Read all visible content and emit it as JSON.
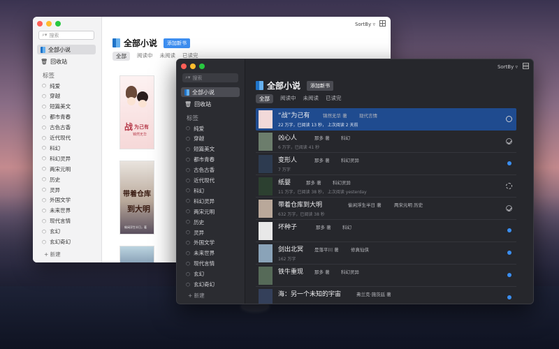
{
  "light_window": {
    "search_placeholder": "搜索",
    "nav": [
      {
        "label": "全部小说",
        "icon": "book-icon"
      },
      {
        "label": "回收站",
        "icon": "trash-icon"
      }
    ],
    "section_tags": "标签",
    "tags": [
      "纯爱",
      "穿越",
      "短篇美文",
      "都市青春",
      "古色古香",
      "近代现代",
      "科幻",
      "科幻灵异",
      "两宋元明",
      "历史",
      "灵异",
      "外国文学",
      "未来世界",
      "现代言情",
      "玄幻",
      "玄幻奇幻"
    ],
    "new_label": "+ 新建",
    "title": "全部小说",
    "add_button": "添加新书",
    "tabs": [
      "全部",
      "阅读中",
      "未阅读",
      "已读完"
    ],
    "sortby": "SortBy ▿",
    "covers": [
      {
        "title_a": "战",
        "title_b": "为己有",
        "author": "锦然无华"
      },
      {
        "title_a": "带着仓库",
        "title_b": "到大明",
        "author": "偷闲浮生半日，著"
      }
    ]
  },
  "dark_window": {
    "search_placeholder": "搜索",
    "nav": [
      {
        "label": "全部小说",
        "icon": "book-icon"
      },
      {
        "label": "回收站",
        "icon": "trash-icon"
      }
    ],
    "section_tags": "标签",
    "tags": [
      "纯爱",
      "穿越",
      "短篇美文",
      "都市青春",
      "古色古香",
      "近代现代",
      "科幻",
      "科幻灵异",
      "两宋元明",
      "历史",
      "灵异",
      "外国文学",
      "未来世界",
      "现代言情",
      "玄幻",
      "玄幻奇幻"
    ],
    "new_label": "+ 新建",
    "title": "全部小说",
    "add_button": "添加新书",
    "tabs": [
      "全部",
      "阅读中",
      "未阅读",
      "已读完"
    ],
    "sortby": "SortBy ▿",
    "books": [
      {
        "name": "“战”为己有",
        "author": "锦然无华 著",
        "tag": "现代言情",
        "sub": "22 万字，已阅读 13 秒，      上次阅读 2 天前",
        "status": "ring",
        "thumb": "#f2d9d9"
      },
      {
        "name": "凶心人",
        "author": "那多 著",
        "tag": "科幻",
        "sub": "6 万字，已阅读 41 秒",
        "status": "check",
        "thumb": "#6c7d6c"
      },
      {
        "name": "变形人",
        "author": "那多 著",
        "tag": "科幻灵异",
        "sub": "7 万字",
        "status": "dot",
        "thumb": "#2d3b50"
      },
      {
        "name": "纸婴",
        "author": "那多 著",
        "tag": "科幻灵异",
        "sub": "11 万字，已阅读 38 秒，      上次阅读 yesterday",
        "status": "spin",
        "thumb": "#2c4030"
      },
      {
        "name": "带着仓库到大明",
        "author": "偷闲浮生半日 著",
        "tag": "两宋元明 历史",
        "sub": "632 万字，已阅读 38 秒",
        "status": "check",
        "thumb": "#b9a89a"
      },
      {
        "name": "坏种子",
        "author": "那多 著",
        "tag": "科幻",
        "sub": "",
        "status": "dot",
        "thumb": "#e8e8e8"
      },
      {
        "name": "剑出北冥",
        "author": "是落平川 著",
        "tag": "修真仙侠",
        "sub": "162 万字",
        "status": "dot",
        "thumb": "#8aa3b8"
      },
      {
        "name": "铁牛重现",
        "author": "那多 著",
        "tag": "科幻灵异",
        "sub": "",
        "status": "dot",
        "thumb": "#566a58"
      },
      {
        "name": "海：另一个未知的宇宙",
        "author": "弗兰克·施茨廷 著",
        "tag": "",
        "sub": "",
        "status": "dot",
        "thumb": "#34405a"
      }
    ]
  }
}
